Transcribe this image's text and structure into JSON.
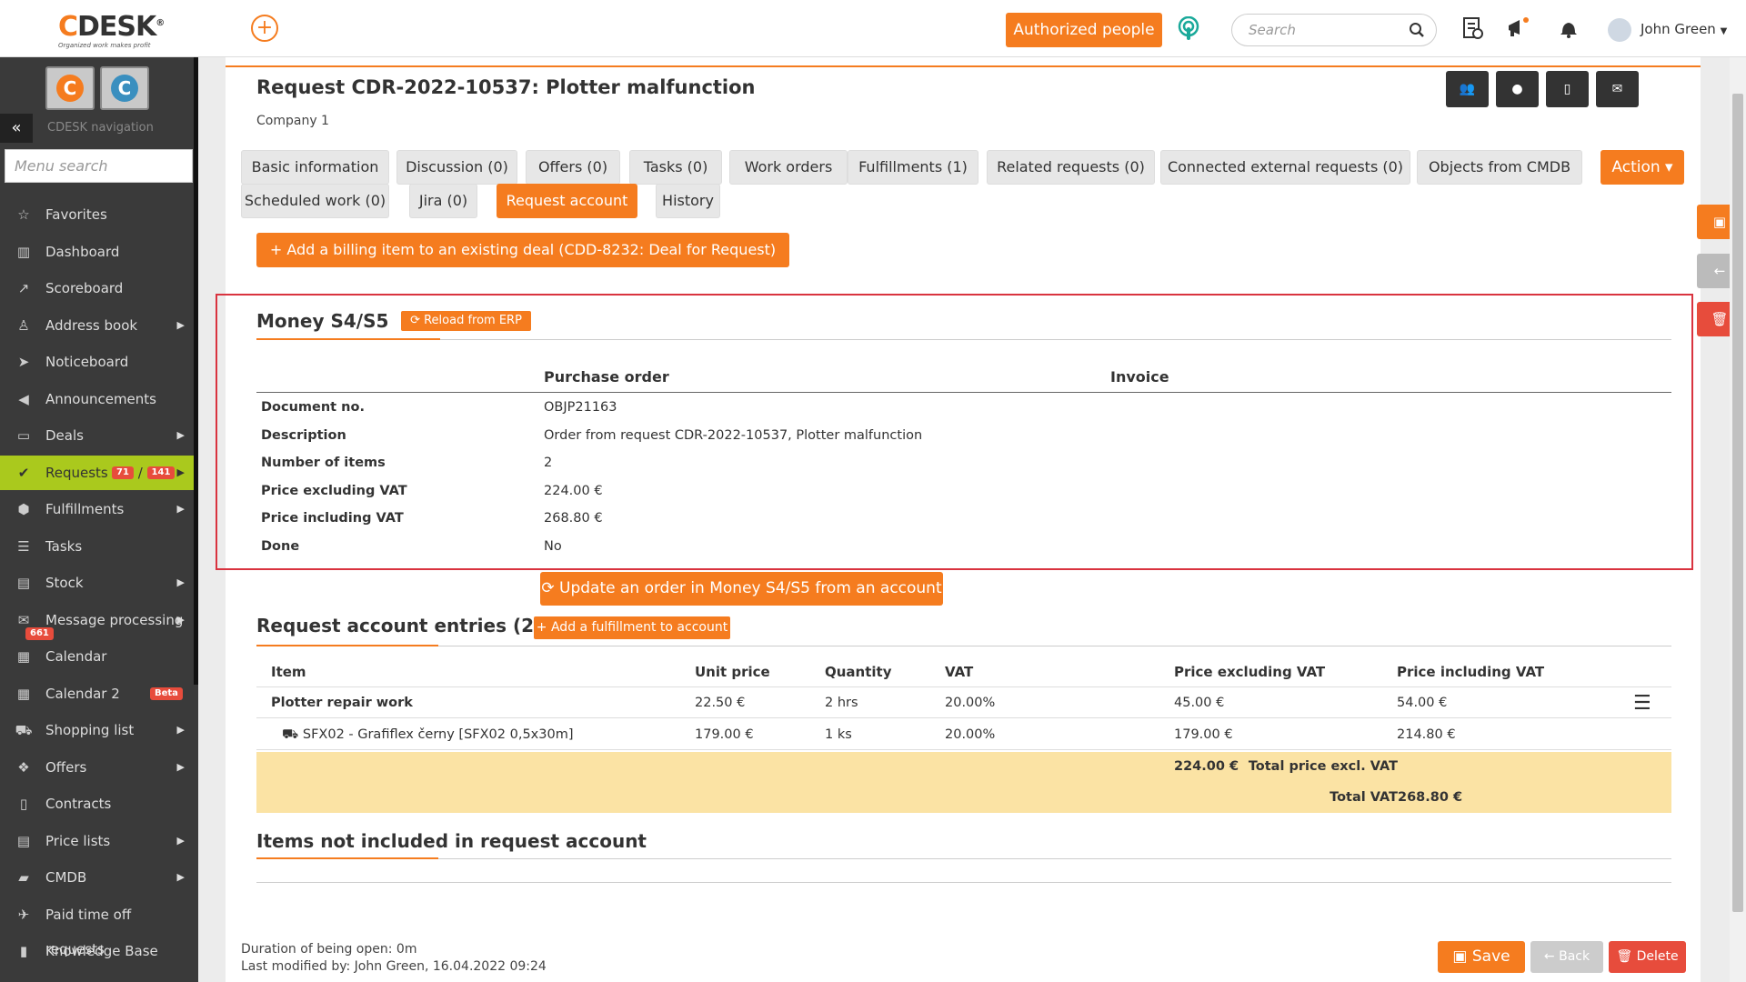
{
  "header": {
    "logo": {
      "c": "C",
      "desk": "DESK",
      "reg": "®",
      "tagline": "Organized work makes profit"
    },
    "authorized_label": "Authorized people",
    "search_placeholder": "Search",
    "user_name": "John Green"
  },
  "sidebar": {
    "nav_label": "CDESK navigation",
    "menu_search_placeholder": "Menu search",
    "items": [
      {
        "label": "Favorites",
        "icon": "star-icon"
      },
      {
        "label": "Dashboard",
        "icon": "bar-chart-icon"
      },
      {
        "label": "Scoreboard",
        "icon": "line-chart-icon"
      },
      {
        "label": "Address book",
        "icon": "user-icon",
        "submenu": true
      },
      {
        "label": "Noticeboard",
        "icon": "paper-plane-icon"
      },
      {
        "label": "Announcements",
        "icon": "megaphone-icon"
      },
      {
        "label": "Deals",
        "icon": "card-icon",
        "submenu": true
      },
      {
        "label": "Requests",
        "icon": "check-circle-icon",
        "submenu": true,
        "active": true,
        "badge1": "71",
        "sep": "/",
        "badge2": "141"
      },
      {
        "label": "Fulfillments",
        "icon": "box-icon",
        "submenu": true
      },
      {
        "label": "Tasks",
        "icon": "tasks-icon"
      },
      {
        "label": "Stock",
        "icon": "archive-icon",
        "submenu": true
      },
      {
        "label": "Message processing",
        "icon": "envelope-icon",
        "submenu": true,
        "badge": "661"
      },
      {
        "label": "Calendar",
        "icon": "calendar-icon"
      },
      {
        "label": "Calendar 2",
        "icon": "calendar-icon",
        "beta": "Beta"
      },
      {
        "label": "Shopping list",
        "icon": "cart-icon",
        "submenu": true
      },
      {
        "label": "Offers",
        "icon": "gift-icon",
        "submenu": true
      },
      {
        "label": "Contracts",
        "icon": "file-icon"
      },
      {
        "label": "Price lists",
        "icon": "file-text-icon",
        "submenu": true
      },
      {
        "label": "CMDB",
        "icon": "folder-icon",
        "submenu": true
      },
      {
        "label": "Paid time off requests",
        "icon": "plane-icon"
      },
      {
        "label": "Knowledge Base",
        "icon": "book-icon"
      }
    ]
  },
  "page": {
    "title": "Request CDR-2022-10537: Plotter malfunction",
    "company": "Company 1",
    "tabs_row1": [
      "Basic information",
      "Discussion (0)",
      "Offers (0)",
      "Tasks (0)",
      "Work orders",
      "Fulfillments (1)",
      "Related requests (0)",
      "Connected external requests (0)",
      "Objects from CMDB"
    ],
    "tabs_row2": [
      "Scheduled work (0)",
      "Jira (0)",
      "Request account",
      "History"
    ],
    "action_label": "Action ▾",
    "add_billing_label": "+ Add a billing item to an existing deal (CDD-8232: Deal for Request)"
  },
  "money": {
    "title": "Money S4/S5",
    "reload_label": "⟳ Reload from ERP",
    "col_po": "Purchase order",
    "col_invoice": "Invoice",
    "rows": [
      {
        "label": "Document no.",
        "value": "OBJP21163"
      },
      {
        "label": "Description",
        "value": "Order from request CDR-2022-10537, Plotter malfunction"
      },
      {
        "label": "Number of items",
        "value": "2"
      },
      {
        "label": "Price excluding VAT",
        "value": "224.00 €"
      },
      {
        "label": "Price including VAT",
        "value": "268.80 €"
      },
      {
        "label": "Done",
        "value": "No"
      }
    ],
    "update_label": "⟳ Update an order in Money S4/S5 from an account"
  },
  "entries": {
    "title": "Request account entries (2)",
    "add_label": "+ Add a fulfillment to account",
    "headers": [
      "Item",
      "Unit price",
      "Quantity",
      "VAT",
      "Price excluding VAT",
      "Price including VAT"
    ],
    "rows": [
      {
        "item": "Plotter repair work",
        "unit": "22.50 €",
        "qty": "2 hrs",
        "vat": "20.00%",
        "excl": "45.00 €",
        "incl": "54.00 €"
      },
      {
        "item": "SFX02 - Grafiflex černy [SFX02 0,5x30m]",
        "unit": "179.00 €",
        "qty": "1 ks",
        "vat": "20.00%",
        "excl": "179.00 €",
        "incl": "214.80 €"
      }
    ],
    "total_excl_label": "Total price excl. VAT",
    "total_excl": "224.00 €",
    "total_vat_label": "Total VAT",
    "total_vat": "268.80 €"
  },
  "not_included": {
    "title": "Items not included in request account"
  },
  "footer": {
    "duration": "Duration of being open: 0m",
    "modified": "Last modified by:  John Green,  16.04.2022 09:24",
    "save": "Save",
    "back": "← Back",
    "delete": "Delete"
  },
  "colors": {
    "accent": "#f57c1f",
    "active_nav": "#aac91d",
    "danger": "#e74c3c",
    "highlight": "#fbe3a4"
  }
}
